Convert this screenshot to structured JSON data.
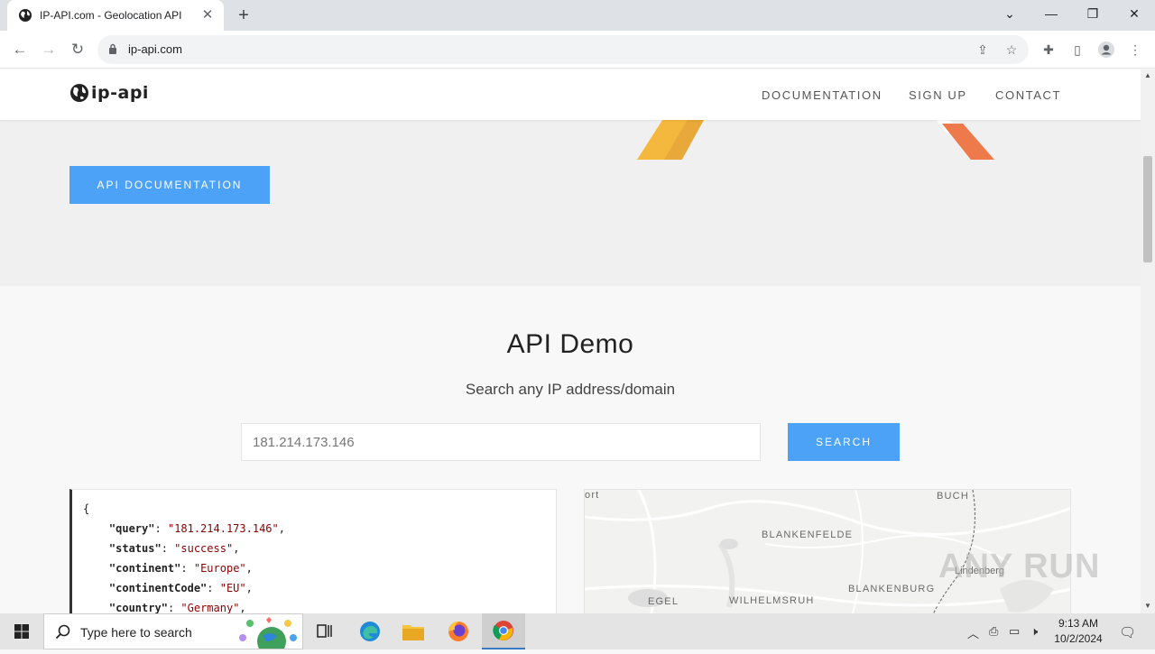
{
  "browser": {
    "tab_title": "IP-API.com - Geolocation API",
    "url": "ip-api.com"
  },
  "site": {
    "logo_text": "ip-api",
    "nav": [
      {
        "label": "DOCUMENTATION"
      },
      {
        "label": "SIGN UP"
      },
      {
        "label": "CONTACT"
      }
    ],
    "hero_button": "API DOCUMENTATION"
  },
  "demo": {
    "title": "API Demo",
    "subtitle": "Search any IP address/domain",
    "input_value": "181.214.173.146",
    "search_button": "SEARCH",
    "json": {
      "open_brace": "{",
      "lines": [
        {
          "key": "\"query\"",
          "value": "\"181.214.173.146\""
        },
        {
          "key": "\"status\"",
          "value": "\"success\""
        },
        {
          "key": "\"continent\"",
          "value": "\"Europe\""
        },
        {
          "key": "\"continentCode\"",
          "value": "\"EU\""
        },
        {
          "key": "\"country\"",
          "value": "\"Germany\""
        }
      ]
    },
    "map_labels": {
      "a": "ort",
      "b": "BUCH",
      "c": "BLANKENFELDE",
      "d": "BLANKENBURG",
      "e": "WILHELMSRUH",
      "f": "EGEL",
      "g": "Lindenberg"
    }
  },
  "watermark": "ANY RUN",
  "taskbar": {
    "search_placeholder": "Type here to search",
    "time": "9:13 AM",
    "date": "10/2/2024"
  },
  "colors": {
    "accent": "#4ca2f7",
    "json_string": "#8b0000"
  }
}
